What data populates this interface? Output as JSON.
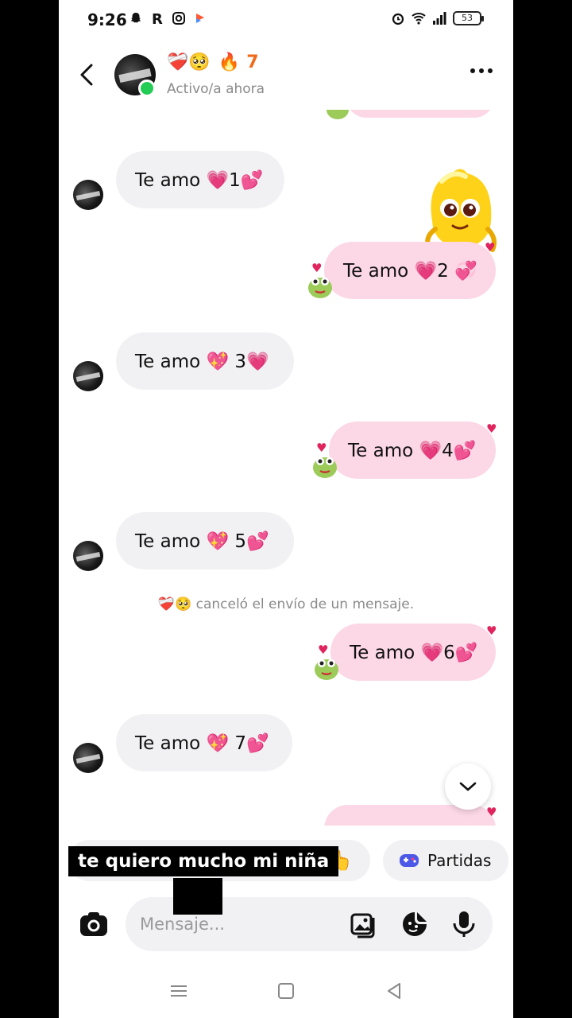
{
  "status_bar": {
    "time": "9:26",
    "battery": "53",
    "left_icons": [
      "snapchat-icon",
      "r-app-icon",
      "instagram-icon",
      "flag-icon"
    ],
    "right_icons": [
      "alarm-icon",
      "wifi-icon",
      "signal-icon",
      "battery-icon"
    ]
  },
  "header": {
    "emojis": "❤️‍🩹🥺",
    "streak_emoji": "🔥",
    "streak_count": "7",
    "status": "Activo/a ahora",
    "online_color": "#22cc55"
  },
  "messages": [
    {
      "side": "in",
      "text": "Te amo 💗1💕"
    },
    {
      "side": "out",
      "text": "Te amo 💗2 💞"
    },
    {
      "side": "in",
      "text": "Te amo 💖 3💗"
    },
    {
      "side": "out",
      "text": "Te amo 💗4💕"
    },
    {
      "side": "in",
      "text": "Te amo 💖 5💕"
    },
    {
      "side": "system",
      "text": "canceló el envío de un mensaje.",
      "emojis": "❤️‍🩹🥺"
    },
    {
      "side": "out",
      "text": "Te amo 💗6💕"
    },
    {
      "side": "in",
      "text": "Te amo 💖 7💕"
    }
  ],
  "quick_actions": {
    "games_label": "Partidas",
    "wave_emoji": "👆"
  },
  "caption": {
    "text": "te quiero mucho mi niña",
    "emoji": "😍"
  },
  "composer": {
    "placeholder": "Mensaje..."
  },
  "colors": {
    "incoming_bubble": "#f1f1f3",
    "outgoing_bubble": "#fcd7e6",
    "streak": "#f06a1a"
  }
}
